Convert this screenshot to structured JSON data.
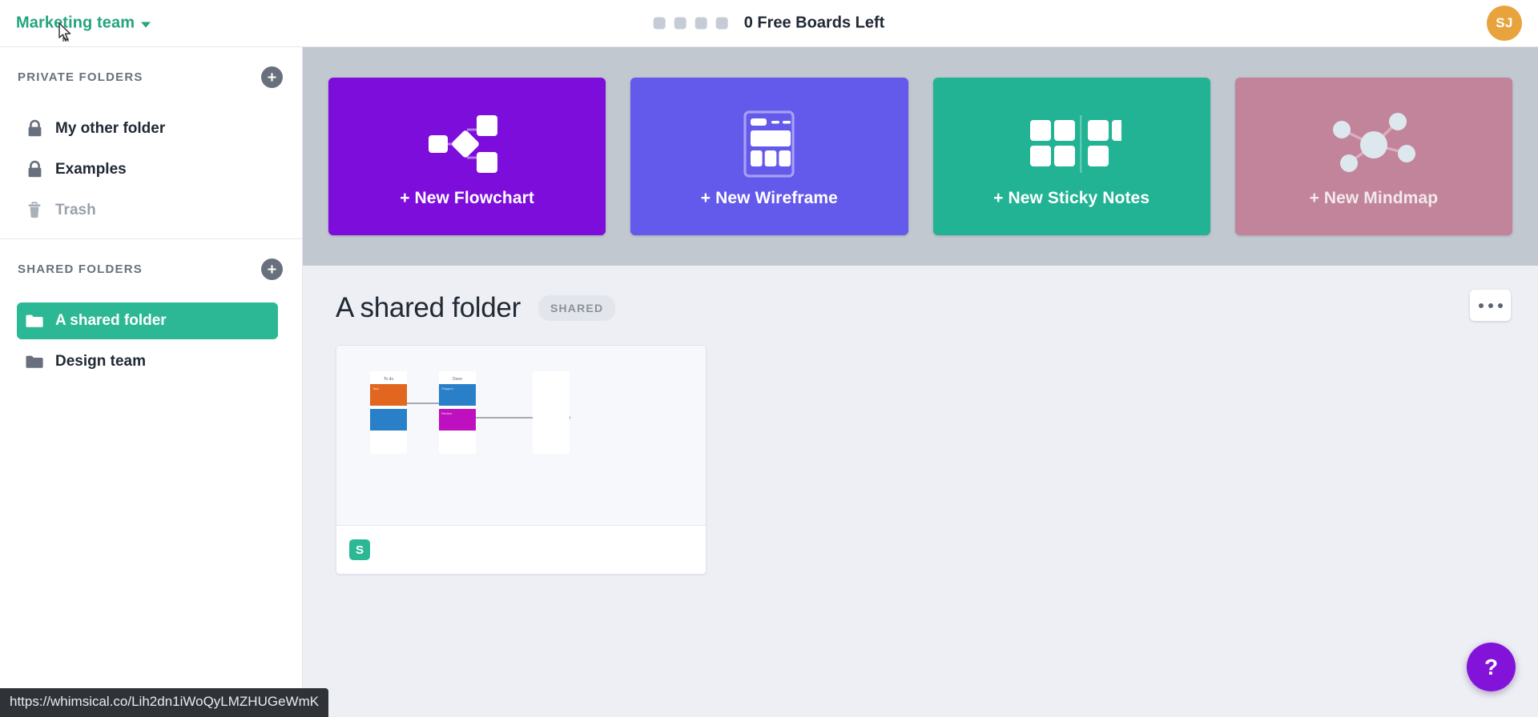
{
  "topbar": {
    "team_name": "Marketing team",
    "team_chevron_icon": "chevron-down-icon",
    "free_boards_label": "0 Free Boards Left",
    "free_board_slots": 4,
    "avatar_initials": "SJ",
    "avatar_color": "#e8a33d",
    "brand_color": "#24a47f"
  },
  "sidebar": {
    "private": {
      "title": "PRIVATE FOLDERS",
      "add_label": "+",
      "items": [
        {
          "label": "My other folder",
          "icon": "lock-icon",
          "state": "normal"
        },
        {
          "label": "Examples",
          "icon": "lock-icon",
          "state": "normal"
        },
        {
          "label": "Trash",
          "icon": "trash-icon",
          "state": "muted"
        }
      ]
    },
    "shared": {
      "title": "SHARED FOLDERS",
      "add_label": "+",
      "items": [
        {
          "label": "A shared folder",
          "icon": "folder-icon",
          "state": "active"
        },
        {
          "label": "Design team",
          "icon": "folder-icon",
          "state": "normal"
        }
      ]
    }
  },
  "create_cards": [
    {
      "label": "+ New Flowchart",
      "icon": "flowchart-icon",
      "color": "#7d0ddb"
    },
    {
      "label": "+ New Wireframe",
      "icon": "wireframe-icon",
      "color": "#6359ea"
    },
    {
      "label": "+ New Sticky Notes",
      "icon": "sticky-notes-icon",
      "color": "#21b394"
    },
    {
      "label": "+ New Mindmap",
      "icon": "mindmap-icon",
      "color": "#c2849a"
    }
  ],
  "folder": {
    "title": "A shared folder",
    "badge": "SHARED",
    "more_icon": "ellipsis-icon"
  },
  "boards": [
    {
      "type_badge": "S",
      "type_badge_color": "#2cb894",
      "thumbnail": {
        "columns": [
          {
            "title": "To do",
            "cards": [
              {
                "color": "#e2661f"
              },
              {
                "color": "#2a7fc9"
              }
            ]
          },
          {
            "title": "Done",
            "cards": [
              {
                "color": "#2a7fc9"
              },
              {
                "color": "#bf10bf"
              }
            ]
          },
          {
            "title": "",
            "cards": []
          }
        ]
      }
    }
  ],
  "help": {
    "label": "?",
    "color": "#8413d9"
  },
  "statusbar": {
    "url": "https://whimsical.co/Lih2dn1iWoQyLMZHUGeWmK"
  }
}
